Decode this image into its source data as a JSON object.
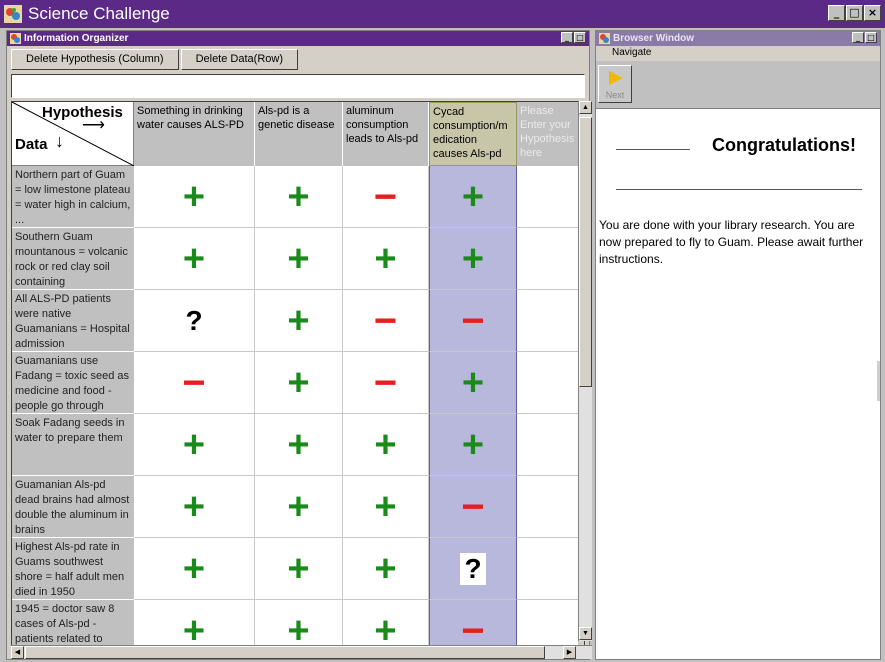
{
  "app": {
    "title": "Science Challenge",
    "controls": [
      "_",
      "□",
      "×"
    ]
  },
  "organizer": {
    "title": "Information Organizer",
    "controls": [
      "_",
      "□"
    ],
    "buttons": {
      "delete_hypothesis": "Delete Hypothesis (Column)",
      "delete_data": "Delete Data(Row)"
    },
    "entry_value": "",
    "corner": {
      "hypothesis": "Hypothesis",
      "data": "Data",
      "arrow_right": "⟶",
      "arrow_down": "↓"
    },
    "columns": [
      {
        "label": "Something in drinking water causes ALS-PD"
      },
      {
        "label": "Als-pd is a genetic disease"
      },
      {
        "label": "aluminum consumption leads to Als-pd"
      },
      {
        "label": "Cycad consumption/medication causes Als-pd",
        "shown": "Cycad consumption/m edication causes Als-pd"
      },
      {
        "label": "Please Enter your Hypothesis here"
      }
    ],
    "rows": [
      {
        "label": "Northern part of Guam = low limestone plateau = water high in calcium, ...",
        "marks": [
          "+",
          "+",
          "−",
          "+",
          ""
        ]
      },
      {
        "label": "Southern Guam mountanous = volcanic rock or red clay soil containing",
        "marks": [
          "+",
          "+",
          "+",
          "+",
          ""
        ]
      },
      {
        "label": "All ALS-PD patients were native Guamanians = Hospital admission",
        "marks": [
          "?",
          "+",
          "−",
          "−",
          ""
        ]
      },
      {
        "label": "Guamanians use Fadang = toxic seed as medicine and food - people go through",
        "marks": [
          "−",
          "+",
          "−",
          "+",
          ""
        ]
      },
      {
        "label": "Soak Fadang seeds in water to prepare them",
        "marks": [
          "+",
          "+",
          "+",
          "+",
          ""
        ]
      },
      {
        "label": "Guamanian Als-pd dead brains had almost double the aluminum in brains",
        "marks": [
          "+",
          "+",
          "+",
          "−",
          ""
        ]
      },
      {
        "label": "Highest Als-pd rate in Guams southwest shore = half adult men died in 1950",
        "marks": [
          "+",
          "+",
          "+",
          "?",
          ""
        ]
      },
      {
        "label": "1945 = doctor saw 8 cases of Als-pd - patients related to",
        "marks": [
          "+",
          "+",
          "+",
          "−",
          ""
        ]
      }
    ],
    "highlighted_column": 4
  },
  "browser": {
    "title": "Browser Window",
    "controls": [
      "_",
      "□"
    ],
    "menu": "Navigate",
    "next_label": "Next",
    "heading": "Congratulations!",
    "message": "You are done with your library research. You are now prepared to fly to Guam. Please await further instructions."
  },
  "colors": {
    "title_bar": "#5a2a86",
    "plus": "#1a8a1a",
    "minus": "#e61e1e",
    "highlight_column": "#b8b8dc"
  }
}
